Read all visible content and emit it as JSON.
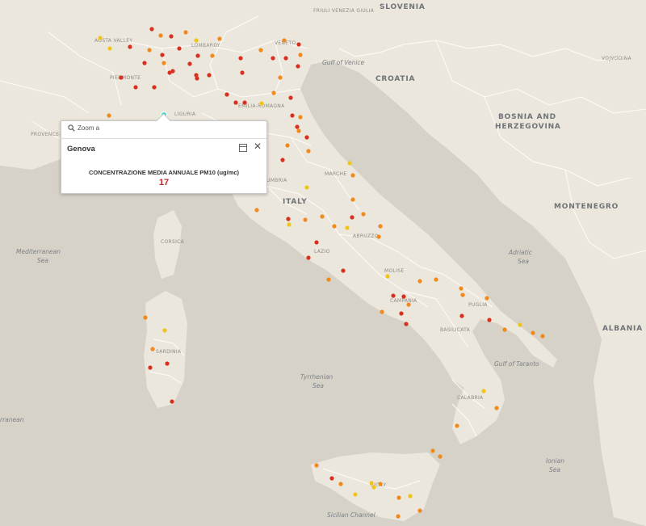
{
  "map": {
    "countries": [
      "SLOVENIA",
      "CROATIA",
      "BOSNIA AND",
      "HERZEGOVINA",
      "MONTENEGRO",
      "ALBANIA",
      "ITALY"
    ],
    "regions": [
      "VOJVODINA",
      "LOMBARDY",
      "VENETO",
      "FRIULI VENEZIA GIULIA",
      "EMILIA-ROMAGNA",
      "LIGURIA",
      "PIEDMONTE",
      "AOSTA VALLEY",
      "PROVENCE-ALPES-COTE D'AZUR",
      "MARCHE",
      "UMBRIA",
      "ABRUZZO",
      "LAZIO",
      "MOLISE",
      "CAMPANIA",
      "PUGLIA",
      "BASILICATA",
      "CALABRIA",
      "SARDINIA",
      "SICILY",
      "CORSICA"
    ],
    "seas": [
      "Gulf of Venice",
      "Adriatic",
      "Sea",
      "Mediterranean",
      "Sea",
      "Tyrrhenian",
      "Sea",
      "Ionian",
      "Sea",
      "Gulf of Taranto",
      "Sicilian Channel",
      "rranean"
    ]
  },
  "popup": {
    "zoom_label": "Zoom a",
    "title": "Genova",
    "field_label": "CONCENTRAZIONE MEDIA ANNUALE PM10 (ug/mc)",
    "value": "17",
    "value_color": "#c62828"
  },
  "legend_colors": {
    "low": "#f0c419",
    "mid": "#f08a1c",
    "high": "#d7301f",
    "selected": "#33d6d0"
  }
}
